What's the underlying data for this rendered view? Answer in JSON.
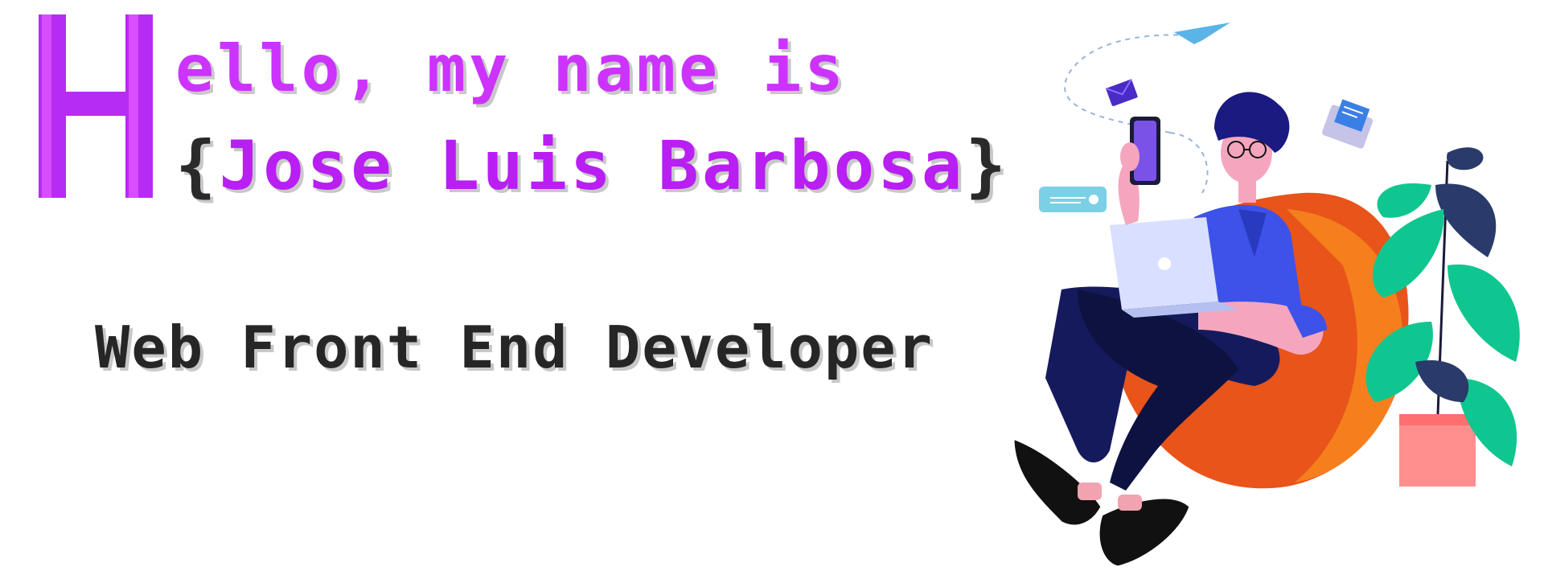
{
  "hero": {
    "initial": "H",
    "greeting": "ello, my name is",
    "brace_open": "{",
    "name": "Jose Luis Barbosa",
    "brace_close": "}",
    "role": "Web Front End Developer"
  },
  "colors": {
    "accent_purple": "#cc33ff",
    "name_purple": "#b91ef2",
    "text_dark": "#262626"
  },
  "illustration": {
    "icons": [
      "paper-plane-icon",
      "envelope-icon",
      "mail-card-icon",
      "chat-bubble-icon",
      "smartphone-icon",
      "laptop-icon",
      "plant-icon",
      "bean-bag-icon"
    ]
  }
}
